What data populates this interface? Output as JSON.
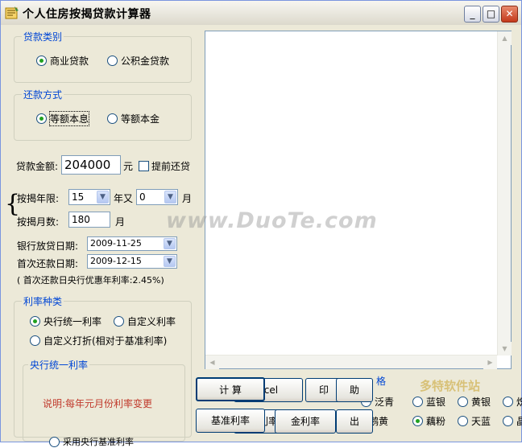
{
  "window": {
    "title": "个人住房按揭贷款计算器",
    "minimize": "_",
    "maximize": "□",
    "close": "✕"
  },
  "loan_type": {
    "legend": "贷款类别",
    "options": [
      "商业贷款",
      "公积金贷款"
    ],
    "selected": "商业贷款"
  },
  "repay_method": {
    "legend": "还款方式",
    "options": [
      "等额本息",
      "等额本金"
    ],
    "selected": "等额本息"
  },
  "amount": {
    "label": "贷款金额:",
    "value": "204000",
    "unit": "元",
    "prepay_label": "提前还贷",
    "prepay_checked": false
  },
  "term": {
    "years_label": "按揭年限:",
    "years": "15",
    "and_label": "年又",
    "months": "0",
    "month_unit": "月",
    "months_label": "按揭月数:",
    "total_months": "180",
    "total_unit": "月",
    "brace": "{"
  },
  "dates": {
    "issue_label": "银行放贷日期:",
    "issue_date": "2009-11-25",
    "first_label": "首次还款日期:",
    "first_date": "2009-12-15",
    "note": "( 首次还款日央行优惠年利率:2.45%)"
  },
  "rate_type": {
    "legend": "利率种类",
    "options": [
      "央行统一利率",
      "自定义利率",
      "自定义打折(相对于基准利率)"
    ],
    "selected": "央行统一利率"
  },
  "central_rate": {
    "legend": "央行统一利率",
    "note": "说明:每年元月份利率变更",
    "note_color": "#c0392b",
    "partial": "采用央行基准利率"
  },
  "buttons": {
    "calc": "计 算",
    "excel": "xcel",
    "print": "印",
    "help": "助",
    "base_rate": "基准利率",
    "rate": "利率",
    "fund_rate": "金利率",
    "exit": "出"
  },
  "skin": {
    "legend": "格",
    "options": [
      "泛青",
      "蓝银",
      "黄银",
      "炽",
      "鹅黄",
      "藕粉",
      "天蓝",
      "晶"
    ],
    "selected": "藕粉"
  },
  "watermarks": {
    "main": "www.DuoTe.com",
    "corner": "多特软件站"
  },
  "colors": {
    "accent": "#0046d5",
    "window_bg": "#ece9d8"
  }
}
